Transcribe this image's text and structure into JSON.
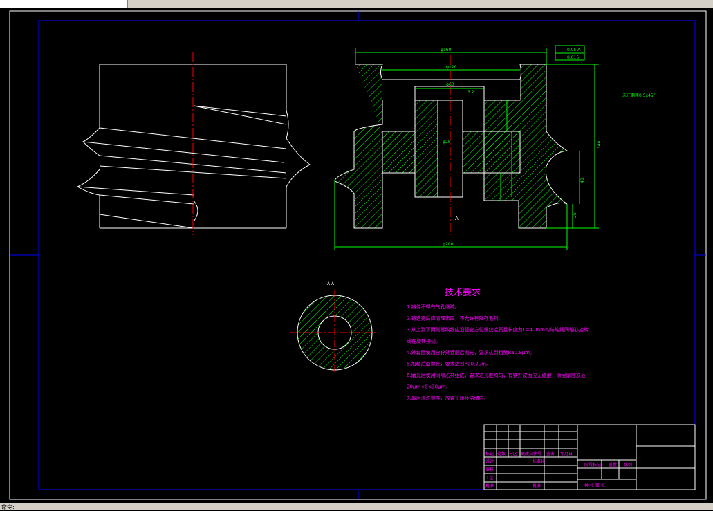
{
  "window": {
    "tab_label": "",
    "status_text": "命令:"
  },
  "drawing": {
    "section_label": "A-A",
    "section_mark": "A",
    "tech_title": "技术要求",
    "requirements": [
      "1.铸件不得有气孔缩疏。",
      "2.铸造完后应清理表面，不允许有残存毛刺。",
      "3.从上到下两侧螺纹线应沿径全方位螺纹连贯且长度为L=40mm均与轴线同轴心旋转",
      "或在旋转接线。",
      "4.外套面使用含锌外镀层后抛光，要求达到粗糙Ra0.8μm。",
      "5.加精后面抛光，要求达到Ra0.7μm。",
      "6.磨光后使用间隙乙共组成，要求达光度均匀，有铁外皮面应无碰痕，涂层厚度须范",
      "20μm<δ<30μm。",
      "7.最后清洗零件，放置干燥及洁储内。"
    ],
    "dims": {
      "top_outer": "φ160",
      "top_inner": "φ120",
      "hub": "φ60",
      "bore": "φ28",
      "bottom": "φ200",
      "height": "140",
      "groove": "40",
      "right_small": "25",
      "gdt1": "0.05 A",
      "gdt2": "0.015",
      "roughness": "3.2",
      "chamfer_note": "未注倒角0.5x45°"
    },
    "title_block": {
      "row1": [
        "标记",
        "处数",
        "分区",
        "更改文件号",
        "签名",
        "年月日"
      ],
      "design": "设计",
      "standard": "标准化",
      "check": "审核",
      "process": "工艺",
      "approve": "批准",
      "stage": "阶段标记",
      "weight": "重量",
      "scale": "比例",
      "sheets": "共   张  第   张"
    }
  },
  "colors": {
    "frame": "#0000ff",
    "geometry": "#ffffff",
    "dimension": "#00ff00",
    "centerline": "#ff0000",
    "text": "#ff00ff",
    "crosshair": "#0000ff"
  }
}
